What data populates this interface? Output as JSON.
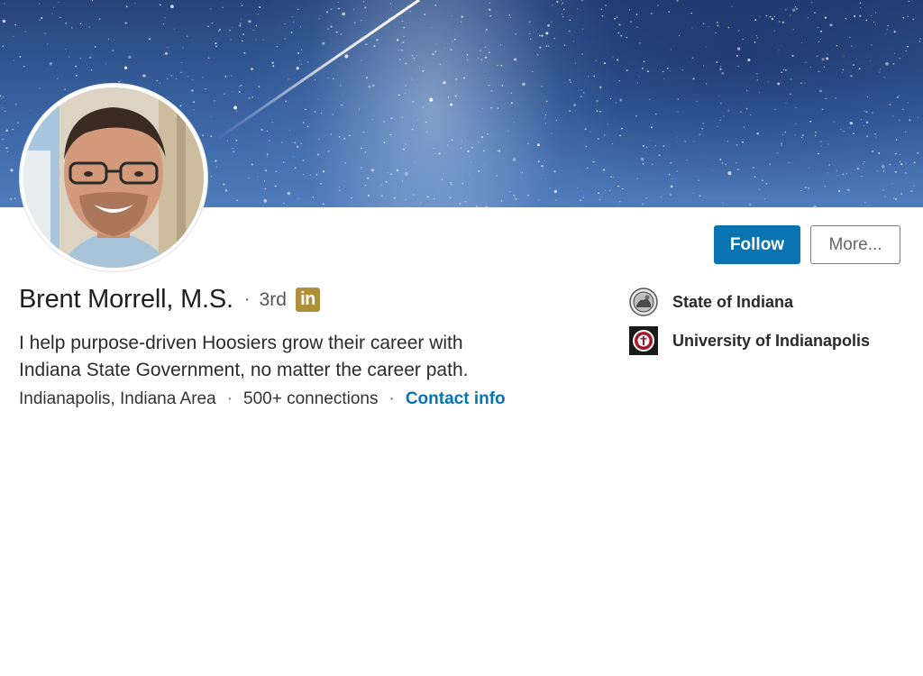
{
  "profile": {
    "name": "Brent Morrell, M.S.",
    "separator": "·",
    "degree": "3rd",
    "badge": "in",
    "headline_line1": "I help purpose-driven Hoosiers grow their career with",
    "headline_line2": "Indiana State Government, no matter the career path.",
    "location": "Indianapolis, Indiana Area",
    "connections": "500+ connections",
    "contact_label": "Contact info"
  },
  "actions": {
    "follow_label": "Follow",
    "more_label": "More..."
  },
  "orgs": [
    {
      "name": "State of Indiana",
      "icon": "state-seal-icon"
    },
    {
      "name": "University of Indianapolis",
      "icon": "university-logo-icon"
    }
  ],
  "colors": {
    "primary": "#0a73b1",
    "badge": "#b08f3a",
    "banner": "#3a63a3"
  }
}
